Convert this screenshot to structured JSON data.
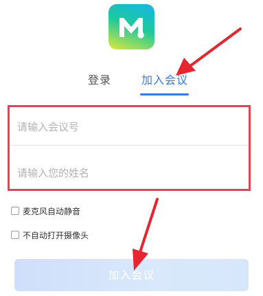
{
  "app": {
    "logo_icon": "app-logo-m-icon",
    "colors": {
      "accent": "#2f7bf0",
      "highlight": "#e84152"
    }
  },
  "tabs": {
    "login_label": "登录",
    "join_label": "加入会议",
    "active": "加入会议"
  },
  "form": {
    "meeting_id_placeholder": "请输入会议号",
    "meeting_id_value": "",
    "name_placeholder": "请输入您的姓名",
    "name_value": ""
  },
  "options": {
    "mic_mute_label": "麦克风自动静音",
    "mic_mute_checked": false,
    "camera_off_label": "不自动打开摄像头",
    "camera_off_checked": false
  },
  "join_button_label": "加入会议",
  "annotations": {
    "arrows": [
      "red-arrow-icon",
      "red-arrow-icon"
    ]
  }
}
